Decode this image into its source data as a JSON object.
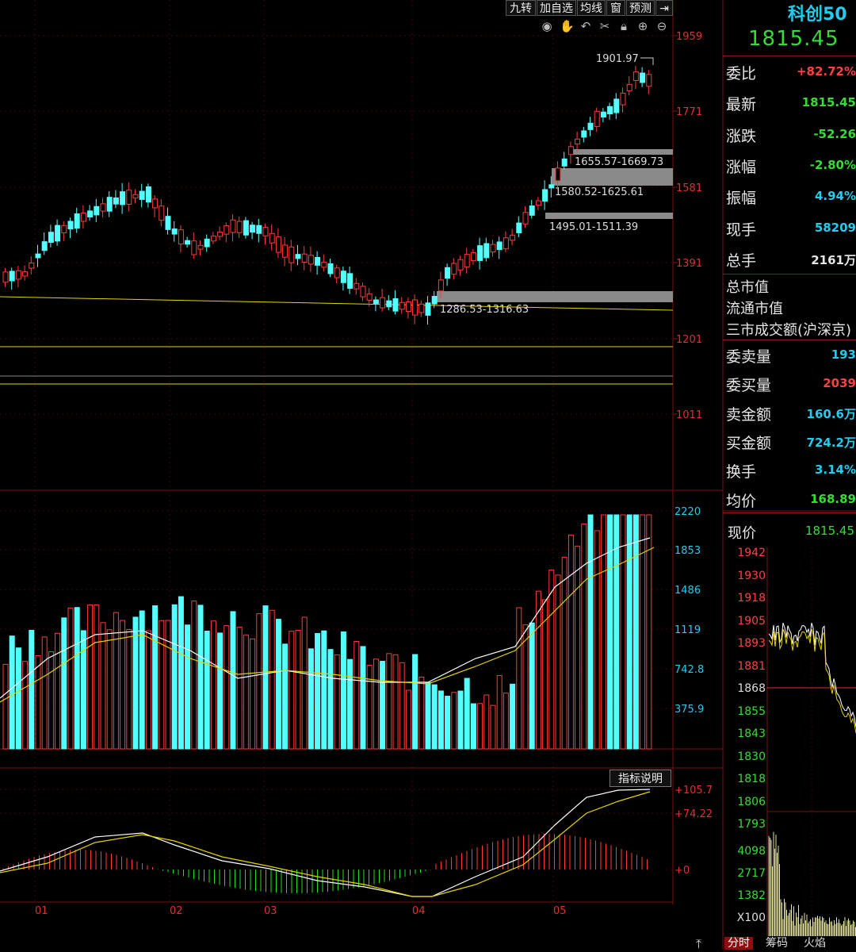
{
  "toolbar": {
    "buttons": [
      "九转",
      "加自选",
      "均线",
      "窗",
      "预测"
    ],
    "icons": [
      "eye-icon",
      "hand-icon",
      "undo-icon",
      "scissors-icon",
      "lock-icon",
      "zoom-in-icon",
      "zoom-out-icon"
    ]
  },
  "main_chart": {
    "price_ticks": [
      "1959",
      "1771",
      "1581",
      "1391",
      "1201",
      "1011"
    ],
    "high_label": "1901.97",
    "zones": [
      "1655.57-1669.73",
      "1580.52-1625.61",
      "1495.01-1511.39",
      "1286.53-1316.63"
    ]
  },
  "volume_chart": {
    "ticks": [
      "2220",
      "1853",
      "1486",
      "1119",
      "742.8",
      "375.9"
    ]
  },
  "macd_chart": {
    "button": "指标说明",
    "ticks": [
      "+105.7",
      "+74.22",
      "+0"
    ],
    "months": [
      "01",
      "02",
      "03",
      "04",
      "05"
    ]
  },
  "quote": {
    "name": "科创50",
    "price": "1815.45",
    "rows": [
      {
        "label": "委比",
        "value": "+82.72%",
        "color": "#ff4040"
      },
      {
        "label": "最新",
        "value": "1815.45",
        "color": "#33dd33"
      },
      {
        "label": "涨跌",
        "value": "-52.26",
        "color": "#33dd33"
      },
      {
        "label": "涨幅",
        "value": "-2.80%",
        "color": "#33dd33"
      },
      {
        "label": "振幅",
        "value": "4.94%",
        "color": "#22ccee"
      },
      {
        "label": "现手",
        "value": "58209",
        "color": "#22ccee"
      },
      {
        "label": "总手",
        "value": "2161万",
        "color": "#e6e6e6"
      }
    ],
    "market_rows": [
      "总市值",
      "流通市值",
      "三市成交额(沪深京)"
    ],
    "rows2": [
      {
        "label": "委卖量",
        "value": "193",
        "color": "#22ccee"
      },
      {
        "label": "委买量",
        "value": "2039",
        "color": "#ff4040"
      },
      {
        "label": "卖金额",
        "value": "160.6万",
        "color": "#22ccee"
      },
      {
        "label": "买金额",
        "value": "724.2万",
        "color": "#22ccee"
      },
      {
        "label": "换手",
        "value": "3.14%",
        "color": "#22ccee"
      },
      {
        "label": "均价",
        "value": "168.89",
        "color": "#33dd33"
      }
    ],
    "now_label": "现价",
    "now_value": "1815.45"
  },
  "intraday": {
    "price_ticks": [
      "1942",
      "1930",
      "1918",
      "1905",
      "1893",
      "1881",
      "1868",
      "1855",
      "1843",
      "1830",
      "1818",
      "1806",
      "1793"
    ],
    "vol_ticks": [
      "4098",
      "2717",
      "1382",
      "X100"
    ]
  },
  "bottom_tabs": [
    "分时",
    "筹码",
    "火焰"
  ],
  "colors": {
    "up": "#ff3b3b",
    "down": "#54ffff",
    "ma_white": "#ffffff",
    "ma_yellow": "#e6d200",
    "grid": "#7a1010"
  }
}
